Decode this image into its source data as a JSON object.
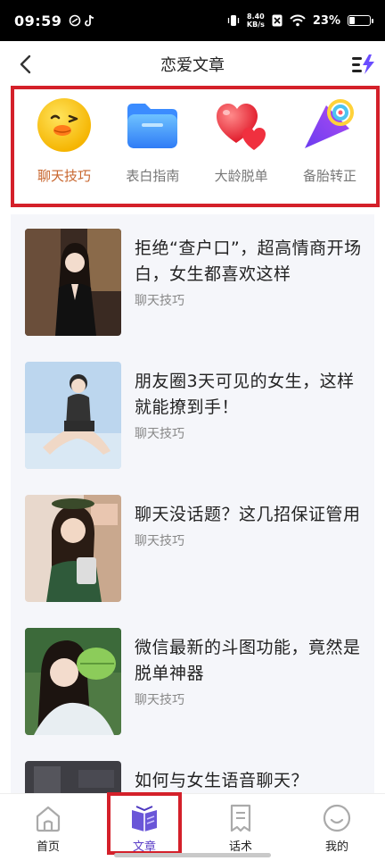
{
  "status_bar": {
    "time": "09:59",
    "speed_top": "8.40",
    "speed_bottom": "KB/s",
    "battery": "23%",
    "battery_level": 0.23
  },
  "header": {
    "title": "恋爱文章"
  },
  "categories": [
    {
      "label": "聊天技巧",
      "icon": "duck-face-icon",
      "active": true
    },
    {
      "label": "表白指南",
      "icon": "folder-icon",
      "active": false
    },
    {
      "label": "大龄脱单",
      "icon": "hearts-icon",
      "active": false
    },
    {
      "label": "备胎转正",
      "icon": "party-cone-icon",
      "active": false
    }
  ],
  "articles": [
    {
      "title": "拒绝“查户口”，超高情商开场白，女生都喜欢这样",
      "tag": "聊天技巧",
      "thumb_icon": "photo-woman-indoor"
    },
    {
      "title": "朋友圈3天可见的女生，这样就能撩到手！",
      "tag": "聊天技巧",
      "thumb_icon": "photo-woman-beach"
    },
    {
      "title": "聊天没话题？这几招保证管用",
      "tag": "聊天技巧",
      "thumb_icon": "photo-woman-selfie"
    },
    {
      "title": "微信最新的斗图功能，竟然是脱单神器",
      "tag": "聊天技巧",
      "thumb_icon": "photo-woman-leaf"
    },
    {
      "title": "如何与女生语音聊天？",
      "tag": "",
      "thumb_icon": "photo-partial"
    }
  ],
  "bottom_nav": [
    {
      "label": "首页",
      "icon": "house-icon",
      "active": false
    },
    {
      "label": "文章",
      "icon": "book-icon",
      "active": true
    },
    {
      "label": "话术",
      "icon": "document-icon",
      "active": false
    },
    {
      "label": "我的",
      "icon": "smiley-icon",
      "active": false
    }
  ],
  "colors": {
    "accent_orange": "#c8662e",
    "nav_active": "#5b3fc7",
    "highlight_red": "#d4202a"
  }
}
